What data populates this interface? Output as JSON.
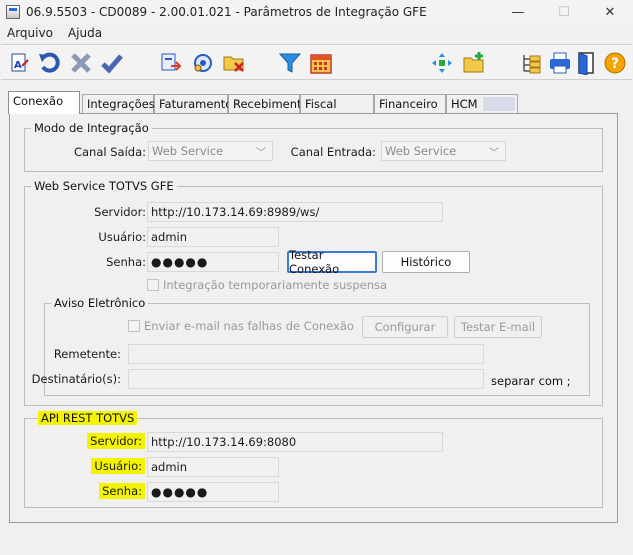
{
  "window": {
    "title": "06.9.5503 - CD0089 - 2.00.01.021 - Parâmetros de Integração GFE",
    "controls": {
      "minimize": "—",
      "maximize": "☐",
      "close": "✕"
    }
  },
  "menubar": {
    "items": [
      "Arquivo",
      "Ajuda"
    ]
  },
  "toolbar": {
    "icons": [
      "edit-text-icon",
      "undo-icon",
      "cancel-x-icon",
      "confirm-check-icon",
      "export-doc-icon",
      "integration-gear-icon",
      "delete-folder-icon",
      "filter-funnel-icon",
      "calendar-icon",
      "move-arrows-icon",
      "new-folder-icon",
      "tree-view-icon",
      "print-icon",
      "exit-door-icon",
      "help-icon"
    ]
  },
  "tabs": [
    "Conexão",
    "Integrações",
    "Faturamento",
    "Recebimento",
    "Fiscal",
    "Financeiro",
    "HCM"
  ],
  "modo": {
    "title": "Modo de Integração",
    "canal_saida_label": "Canal Saída:",
    "canal_saida_value": "Web Service",
    "canal_entrada_label": "Canal Entrada:",
    "canal_entrada_value": "Web Service"
  },
  "ws": {
    "title": "Web Service TOTVS GFE",
    "servidor_label": "Servidor:",
    "servidor_value": "http://10.173.14.69:8989/ws/",
    "usuario_label": "Usuário:",
    "usuario_value": "admin",
    "senha_label": "Senha:",
    "senha_value": "●●●●●",
    "testar_label": "Testar Conexão",
    "historico_label": "Histórico",
    "suspensa_label": "Integração temporariamente suspensa"
  },
  "aviso": {
    "title": "Aviso Eletrônico",
    "enviar_label": "Enviar e-mail nas falhas de Conexão",
    "configurar_label": "Configurar",
    "testar_email_label": "Testar E-mail",
    "remetente_label": "Remetente:",
    "destinatarios_label": "Destinatário(s):",
    "separar_label": "separar com ;"
  },
  "api": {
    "title": "API REST TOTVS",
    "servidor_label": "Servidor:",
    "servidor_value": "http://10.173.14.69:8080",
    "usuario_label": "Usuário:",
    "usuario_value": "admin",
    "senha_label": "Senha:",
    "senha_value": "●●●●●"
  },
  "colors": {
    "highlight": "#f4f400",
    "accent": "#3d7ad6"
  }
}
